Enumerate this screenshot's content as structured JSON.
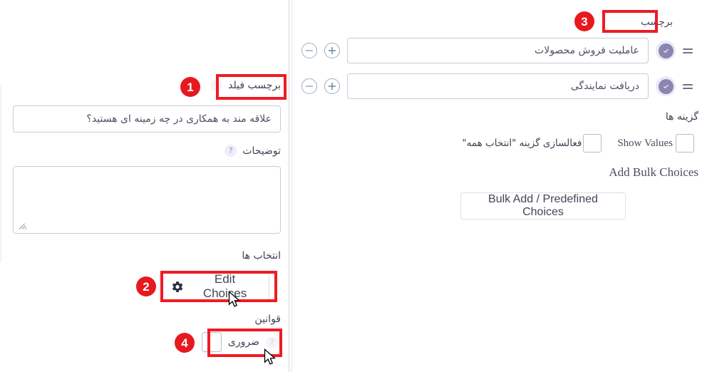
{
  "left_panel": {
    "field_label": {
      "label": "برچسب فیلد",
      "help_icon": "question-mark-icon",
      "value": "علاقه مند به همکاری در چه زمینه ای هستید؟"
    },
    "description": {
      "label": "توضیحات",
      "help_icon": "question-mark-icon",
      "value": ""
    },
    "choices": {
      "label": "انتخاب ها",
      "edit_button": "Edit Choices",
      "gear_icon": "gear-icon"
    },
    "rules": {
      "label": "قوانین",
      "required_label": "ضروری",
      "required_checked": false,
      "help_icon": "question-mark-icon"
    }
  },
  "right_panel": {
    "header": {
      "label": "برچسب"
    },
    "choice_rows": [
      {
        "value": "عاملیت فروش محصولات",
        "check_icon": "check-circle-icon",
        "drag_icon": "drag-handle-icon",
        "add_icon": "plus-circle-icon",
        "remove_icon": "minus-circle-icon"
      },
      {
        "value": "دریافت نمایندگی",
        "check_icon": "check-circle-icon",
        "drag_icon": "drag-handle-icon",
        "add_icon": "plus-circle-icon",
        "remove_icon": "minus-circle-icon"
      }
    ],
    "options": {
      "label": "گزینه ها",
      "show_values_label": "Show Values",
      "show_values_checked": false,
      "select_all_label": "فعالسازی گزینه \"انتخاب همه\"",
      "select_all_checked": false
    },
    "bulk": {
      "label": "Add Bulk Choices",
      "button": "Bulk Add / Predefined Choices"
    }
  },
  "annotations": {
    "badges": [
      {
        "number": "1"
      },
      {
        "number": "2"
      },
      {
        "number": "3"
      },
      {
        "number": "4"
      }
    ],
    "accent_color": "#e8181f"
  }
}
